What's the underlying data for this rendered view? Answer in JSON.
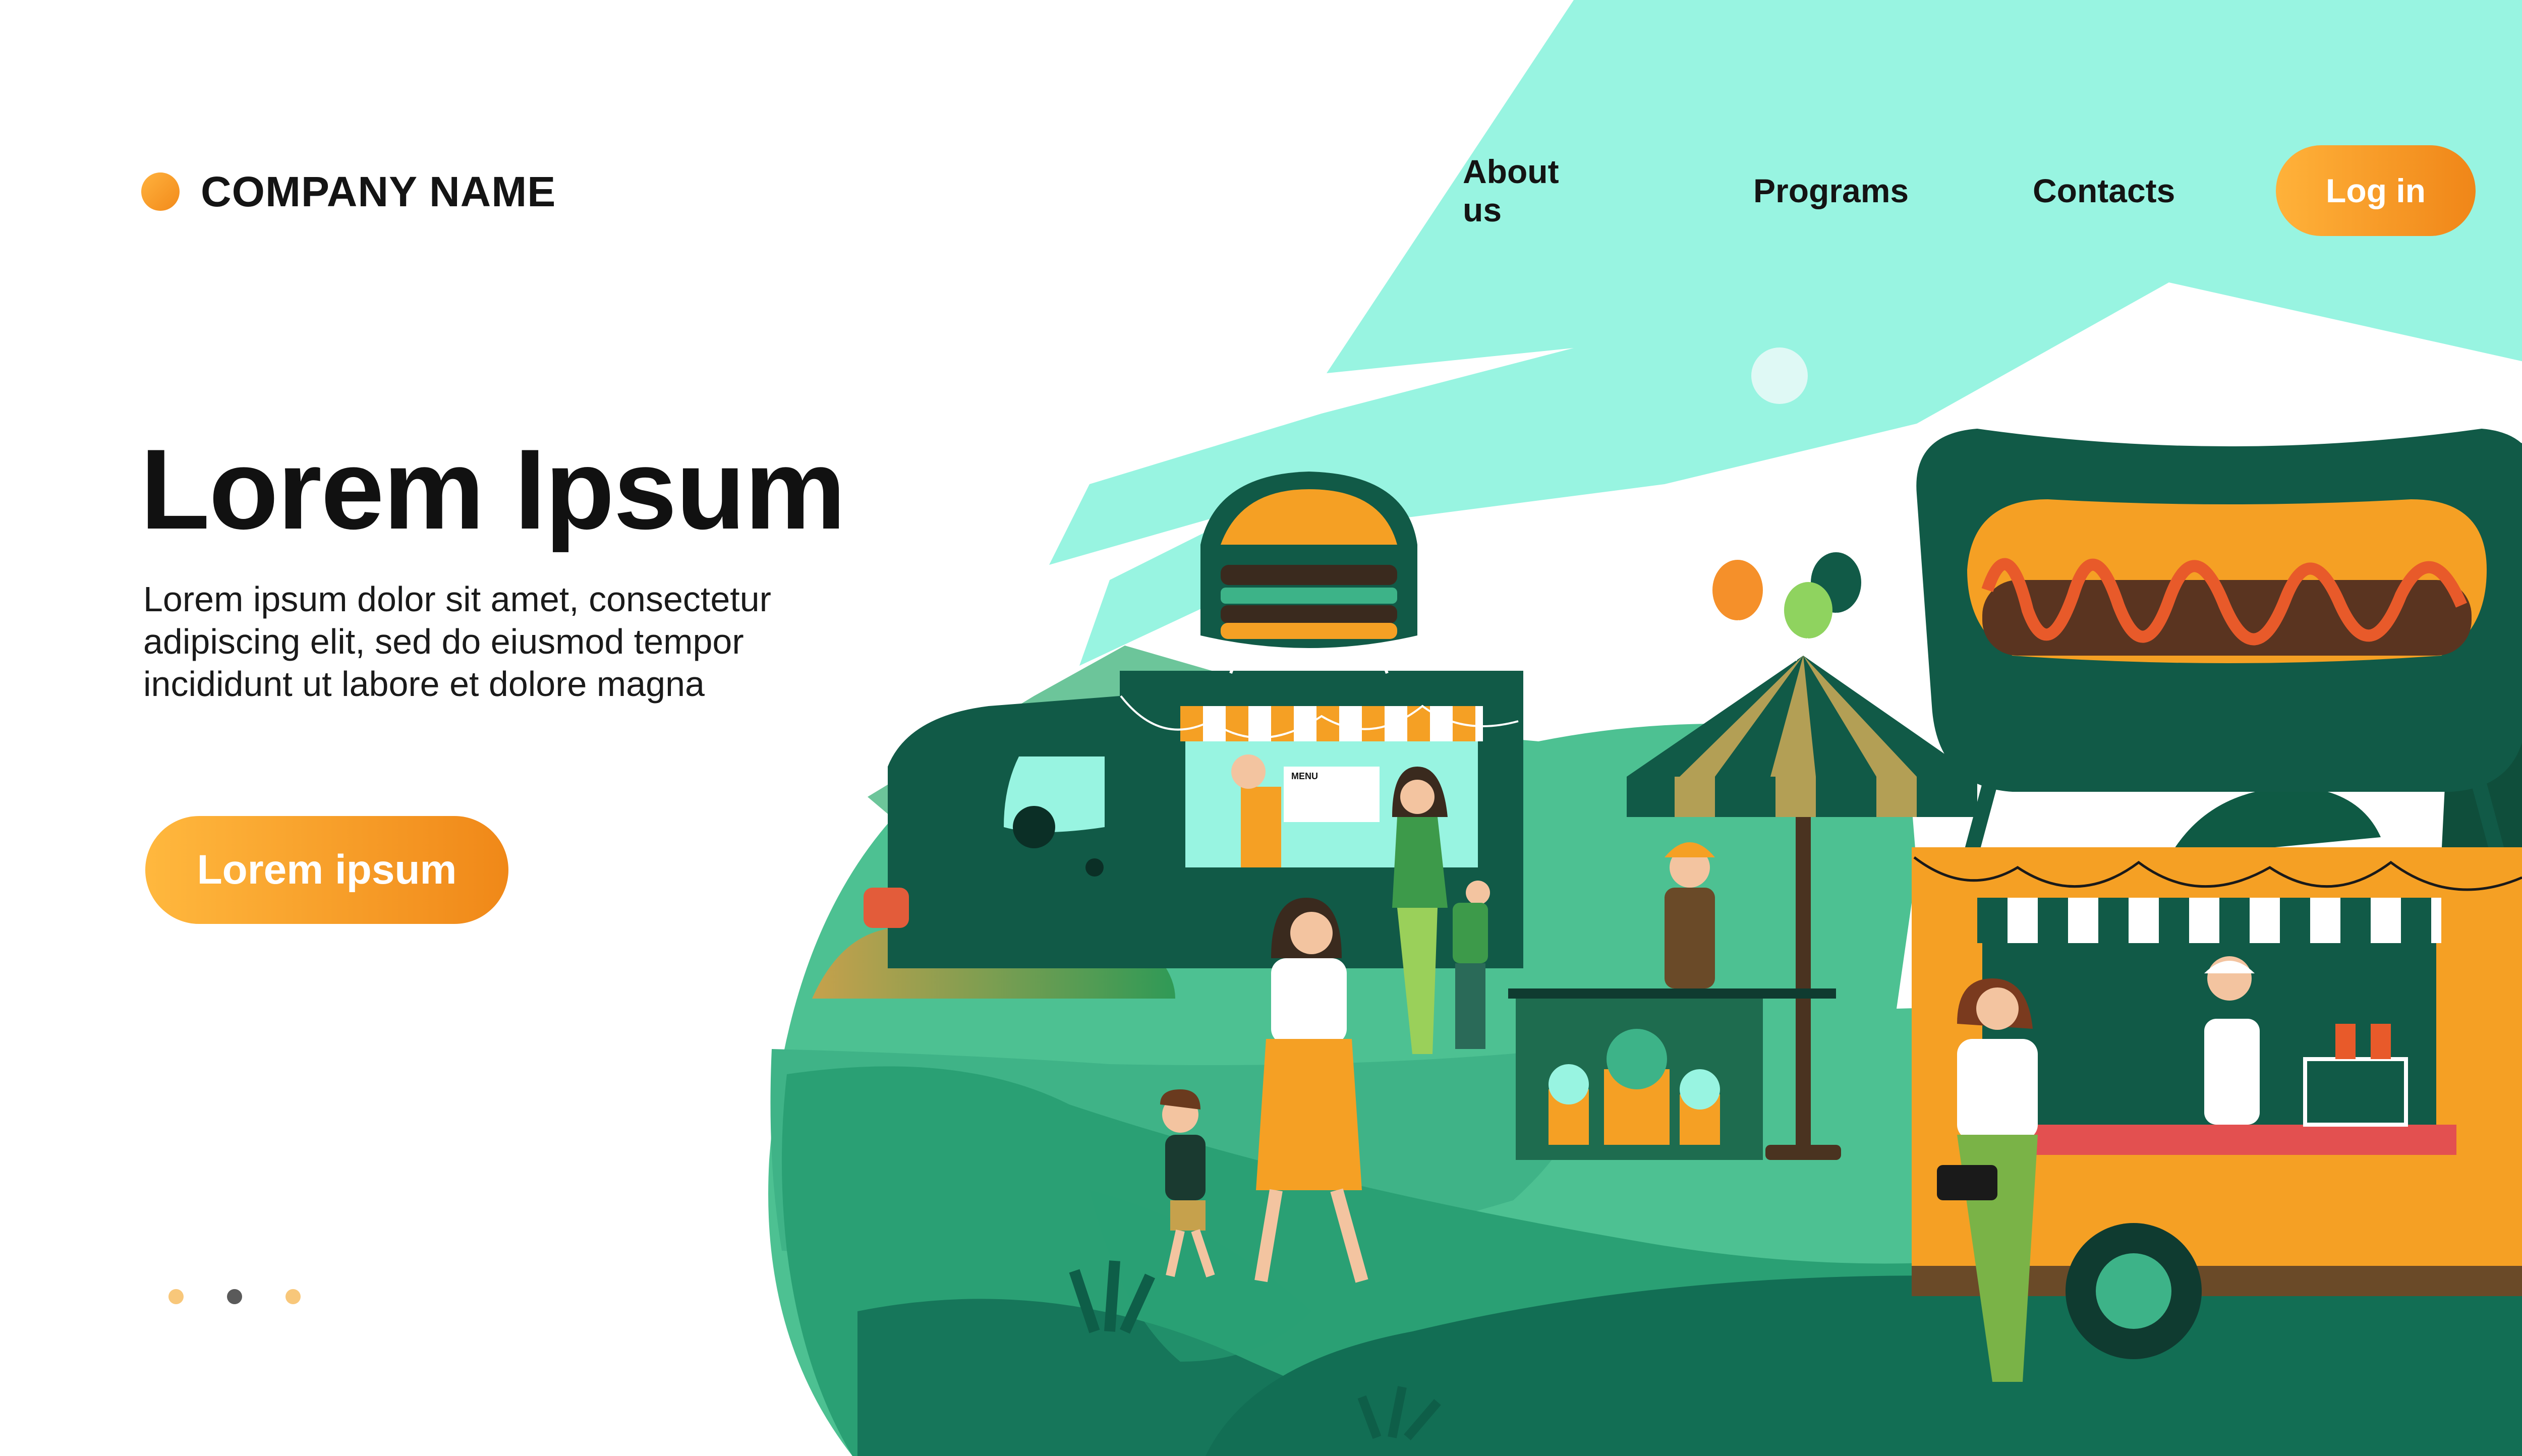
{
  "header": {
    "logo_text": "COMPANY NAME",
    "nav": [
      "About us",
      "Programs",
      "Contacts"
    ],
    "login_label": "Log in"
  },
  "hero": {
    "title": "Lorem Ipsum",
    "text_lines": [
      "Lorem ipsum dolor sit amet, consectetur",
      "adipiscing elit, sed do eiusmod tempor",
      "incididunt ut labore et dolore magna"
    ],
    "cta_label": "Lorem ipsum"
  },
  "illustration": {
    "burger_menu_label": "MENU"
  },
  "pagination": {
    "count": 3,
    "active_index": 1
  },
  "colors": {
    "accent_orange": "#F59A23",
    "mint": "#98F4E1",
    "dark_green": "#115A47",
    "mid_green": "#3DB388",
    "light_green": "#4CC191",
    "text": "#141414",
    "dot_inactive": "#F8C77A",
    "dot_active": "#5A5A5A"
  }
}
